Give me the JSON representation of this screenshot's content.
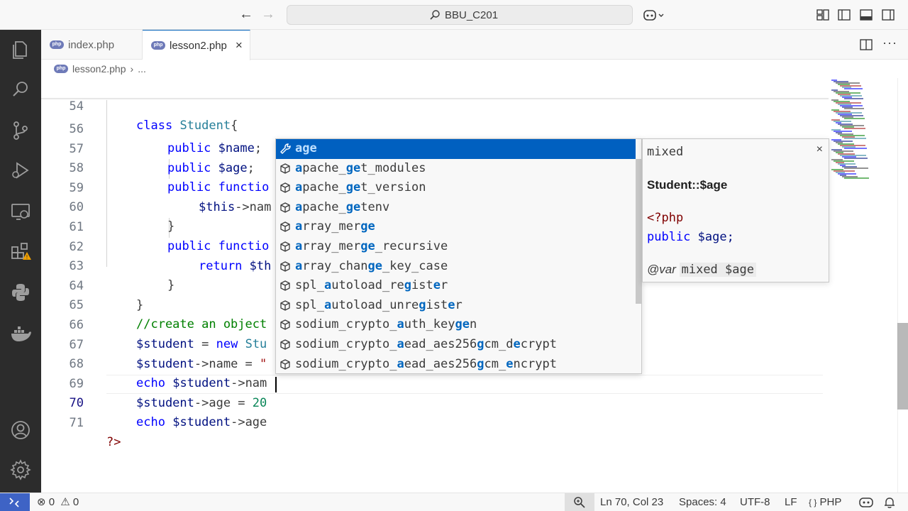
{
  "window": {
    "title": "BBU_C201",
    "nav_back": "←",
    "nav_forward": "→"
  },
  "tabs": [
    {
      "label": "index.php",
      "active": false
    },
    {
      "label": "lesson2.php",
      "active": true,
      "close": "×"
    }
  ],
  "breadcrumb": {
    "file": "lesson2.php",
    "separator": "›",
    "rest": "..."
  },
  "editor": {
    "current_line": 70,
    "lines": [
      {
        "n": "54"
      },
      {
        "n": "56"
      },
      {
        "n": "57"
      },
      {
        "n": "58"
      },
      {
        "n": "59"
      },
      {
        "n": "60"
      },
      {
        "n": "61"
      },
      {
        "n": "62"
      },
      {
        "n": "63"
      },
      {
        "n": "64"
      },
      {
        "n": "65"
      },
      {
        "n": "66"
      },
      {
        "n": "67"
      },
      {
        "n": "68"
      },
      {
        "n": "69"
      },
      {
        "n": "70"
      },
      {
        "n": "71"
      }
    ],
    "code": {
      "l54_kw": "class",
      "l54_cls": "Student",
      "l54_brace": "{",
      "l56_kw": "public",
      "l56_var": "$name",
      "l56_semi": ";",
      "l57_kw": "public",
      "l57_var": "$age",
      "l57_semi": ";",
      "l58_kw": "public",
      "l58_rest": "functio",
      "l59_var": "$this",
      "l59_rest": "->nam",
      "l60_brace": "}",
      "l61_kw": "public",
      "l61_rest": "functio",
      "l62_kw": "return",
      "l62_var": "$th",
      "l63_brace": "}",
      "l64_brace": "}",
      "l65_cmt": "//create an object",
      "l66_var": "$student",
      "l66_eq": " = ",
      "l66_kw": "new",
      "l66_cls": "Stu",
      "l67_var": "$student",
      "l67_rest": "->name = ",
      "l67_str": "\"",
      "l68_kw": "echo",
      "l68_var": "$student",
      "l68_rest": "->nam",
      "l69_var": "$student",
      "l69_rest": "->age = ",
      "l69_num": "20",
      "l70_kw": "echo",
      "l70_var": "$student",
      "l70_rest": "->age",
      "l71_php": "?>"
    }
  },
  "suggest": {
    "items": [
      {
        "label": "age",
        "highlight": [
          0,
          3
        ],
        "kind": "property-icon",
        "selected": true
      },
      {
        "label": "apache_get_modules",
        "kind": "method-icon"
      },
      {
        "label": "apache_get_version",
        "kind": "method-icon"
      },
      {
        "label": "apache_getenv",
        "kind": "method-icon"
      },
      {
        "label": "array_merge",
        "kind": "method-icon"
      },
      {
        "label": "array_merge_recursive",
        "kind": "method-icon"
      },
      {
        "label": "array_change_key_case",
        "kind": "method-icon"
      },
      {
        "label": "spl_autoload_register",
        "kind": "method-icon"
      },
      {
        "label": "spl_autoload_unregister",
        "kind": "method-icon"
      },
      {
        "label": "sodium_crypto_auth_keygen",
        "kind": "method-icon"
      },
      {
        "label": "sodium_crypto_aead_aes256gcm_decrypt",
        "kind": "method-icon"
      },
      {
        "label": "sodium_crypto_aead_aes256gcm_encrypt",
        "kind": "method-icon"
      }
    ]
  },
  "details": {
    "type": "mixed",
    "close": "×",
    "symbol": "Student::$age",
    "code_open": "<?php",
    "code_decl": "public $age;",
    "doc_tag": "@var",
    "doc_code": "mixed $age"
  },
  "status": {
    "errors": "0",
    "warnings": "0",
    "position": "Ln 70, Col 23",
    "spaces": "Spaces: 4",
    "encoding": "UTF-8",
    "eol": "LF",
    "language_braces": "{ }",
    "language": "PHP"
  },
  "colors": {
    "accent": "#005fb8",
    "selection": "#0060c0",
    "keyword": "#0000ff",
    "comment": "#008000",
    "remote": "#3e63c5"
  }
}
